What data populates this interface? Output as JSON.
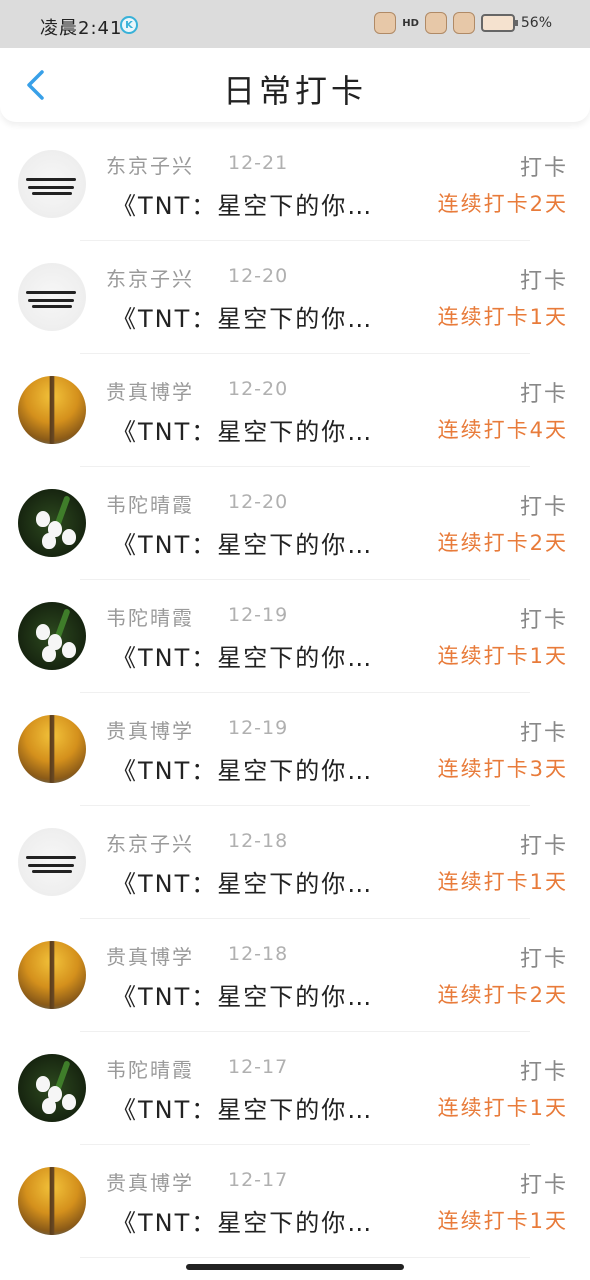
{
  "status_bar": {
    "time": "凌晨2:41",
    "app_badge": "K",
    "hd_label": "HD",
    "battery": "56%"
  },
  "header": {
    "title": "日常打卡",
    "back_icon": "chevron-left-icon"
  },
  "colors": {
    "accent": "#38a0e8",
    "streak": "#e87b3a",
    "muted": "#9a9a9a"
  },
  "items": [
    {
      "name": "东京子兴",
      "date": "12-21",
      "type": "打卡",
      "content": "《TNT：星空下的你…",
      "streak": "连续打卡2天",
      "avatar": "calligraphy"
    },
    {
      "name": "东京子兴",
      "date": "12-20",
      "type": "打卡",
      "content": "《TNT：星空下的你…",
      "streak": "连续打卡1天",
      "avatar": "calligraphy"
    },
    {
      "name": "贵真博学",
      "date": "12-20",
      "type": "打卡",
      "content": "《TNT：星空下的你…",
      "streak": "连续打卡4天",
      "avatar": "autumn"
    },
    {
      "name": "韦陀晴霞",
      "date": "12-20",
      "type": "打卡",
      "content": "《TNT：星空下的你…",
      "streak": "连续打卡2天",
      "avatar": "flower"
    },
    {
      "name": "韦陀晴霞",
      "date": "12-19",
      "type": "打卡",
      "content": "《TNT：星空下的你…",
      "streak": "连续打卡1天",
      "avatar": "flower"
    },
    {
      "name": "贵真博学",
      "date": "12-19",
      "type": "打卡",
      "content": "《TNT：星空下的你…",
      "streak": "连续打卡3天",
      "avatar": "autumn"
    },
    {
      "name": "东京子兴",
      "date": "12-18",
      "type": "打卡",
      "content": "《TNT：星空下的你…",
      "streak": "连续打卡1天",
      "avatar": "calligraphy"
    },
    {
      "name": "贵真博学",
      "date": "12-18",
      "type": "打卡",
      "content": "《TNT：星空下的你…",
      "streak": "连续打卡2天",
      "avatar": "autumn"
    },
    {
      "name": "韦陀晴霞",
      "date": "12-17",
      "type": "打卡",
      "content": "《TNT：星空下的你…",
      "streak": "连续打卡1天",
      "avatar": "flower"
    },
    {
      "name": "贵真博学",
      "date": "12-17",
      "type": "打卡",
      "content": "《TNT：星空下的你…",
      "streak": "连续打卡1天",
      "avatar": "autumn"
    }
  ]
}
